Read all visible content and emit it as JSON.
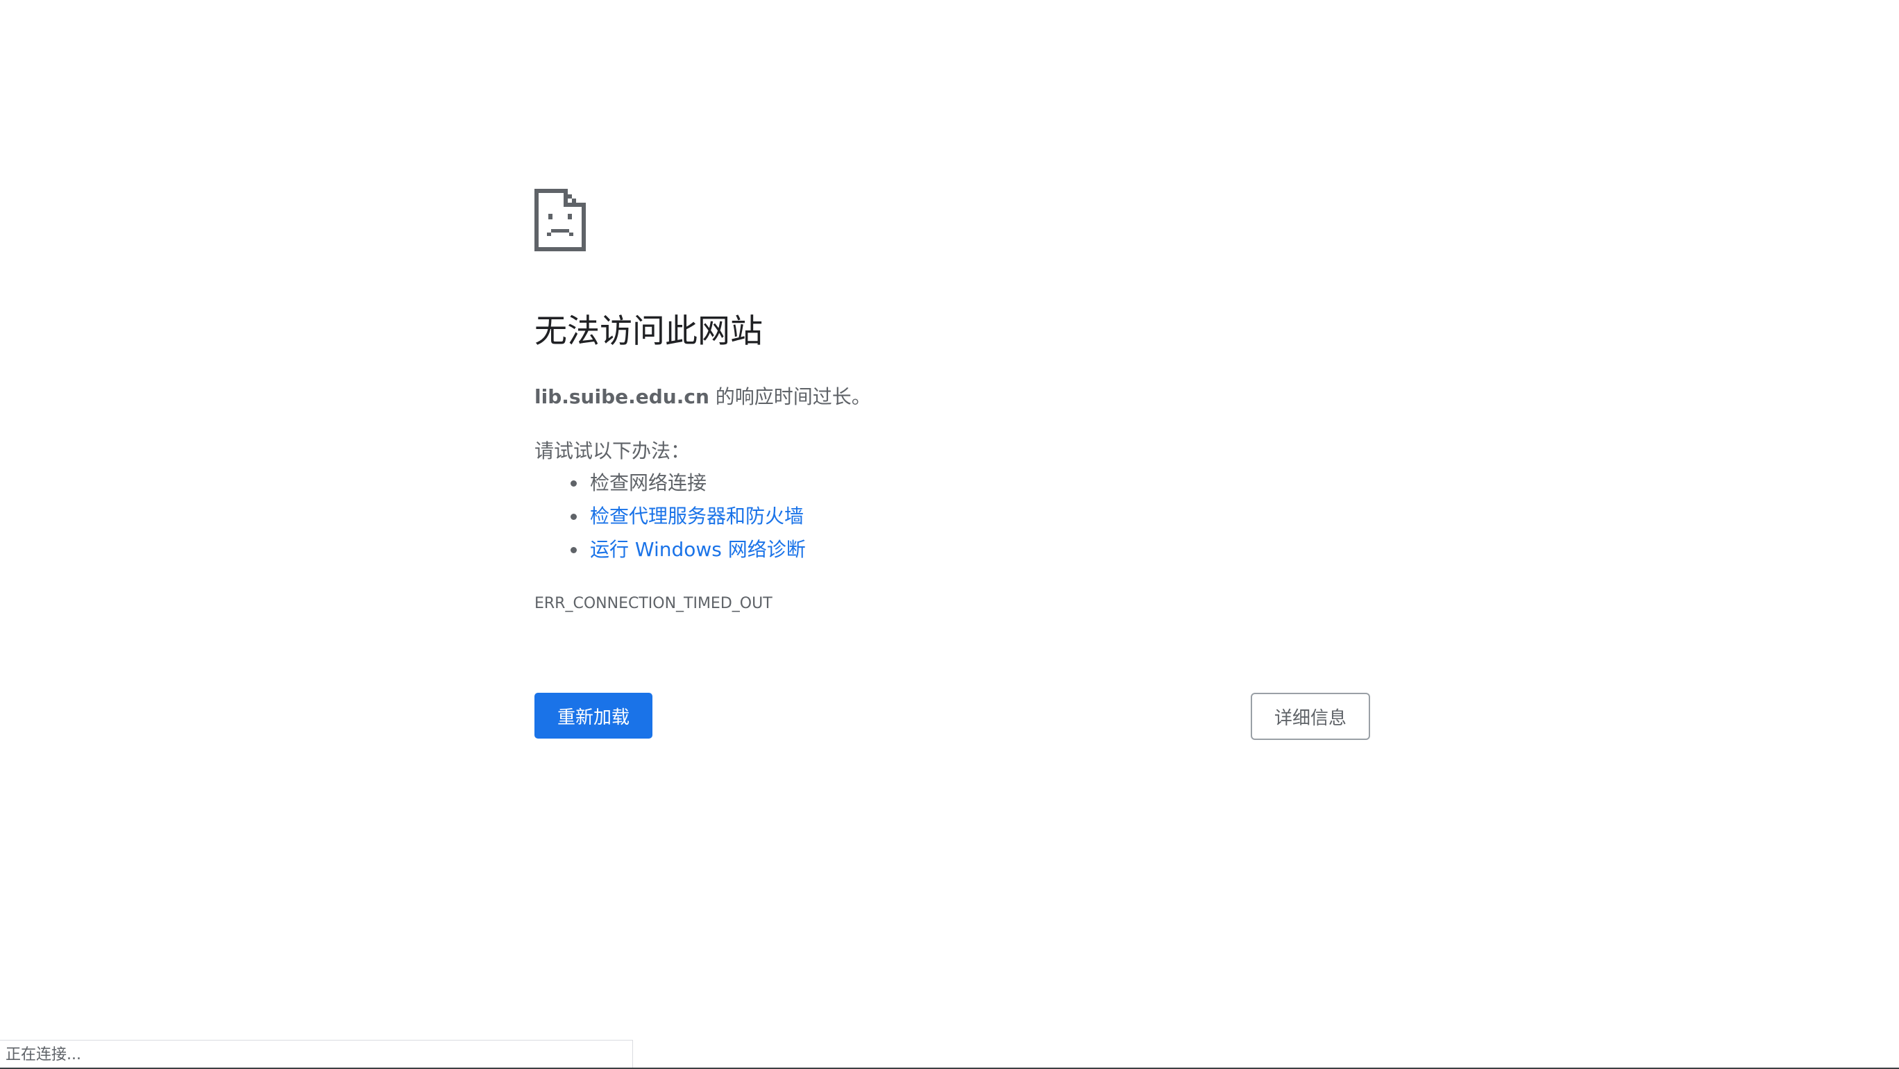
{
  "error_page": {
    "icon": "sad-document-icon",
    "title": "无法访问此网站",
    "host": "lib.suibe.edu.cn",
    "description_suffix": " 的响应时间过长。",
    "suggestions_title": "请试试以下办法：",
    "suggestions": [
      {
        "label": "检查网络连接",
        "is_link": false
      },
      {
        "label": "检查代理服务器和防火墙",
        "is_link": true
      },
      {
        "label": "运行 Windows 网络诊断",
        "is_link": true
      }
    ],
    "error_code": "ERR_CONNECTION_TIMED_OUT",
    "reload_label": "重新加载",
    "details_label": "详细信息"
  },
  "status_bar": {
    "text": "正在连接..."
  },
  "colors": {
    "accent": "#1a73e8",
    "text_secondary": "#5f6368",
    "title": "#202124",
    "icon": "#5f6368"
  }
}
